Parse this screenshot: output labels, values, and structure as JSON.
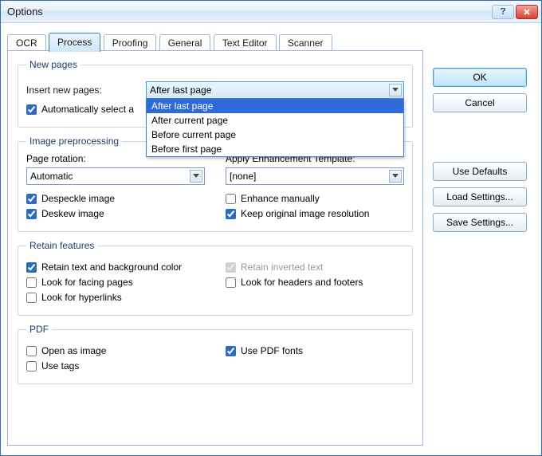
{
  "window": {
    "title": "Options"
  },
  "tabs": [
    "OCR",
    "Process",
    "Proofing",
    "General",
    "Text Editor",
    "Scanner"
  ],
  "activeTab": 1,
  "newPages": {
    "legend": "New pages",
    "insertLabel": "Insert new pages:",
    "selected": "After last page",
    "options": [
      "After last page",
      "After current page",
      "Before current page",
      "Before first page"
    ],
    "autoSelect": {
      "label": "Automatically select a",
      "checked": true
    }
  },
  "imagePre": {
    "legend": "Image preprocessing",
    "pageRotationLabel": "Page rotation:",
    "pageRotationValue": "Automatic",
    "enhLabel": "Apply Enhancement Template:",
    "enhValue": "[none]",
    "despeckle": {
      "label": "Despeckle image",
      "checked": true
    },
    "deskew": {
      "label": "Deskew image",
      "checked": true
    },
    "enhanceManually": {
      "label": "Enhance manually",
      "checked": false
    },
    "keepRes": {
      "label": "Keep original image resolution",
      "checked": true
    }
  },
  "retain": {
    "legend": "Retain features",
    "retainColor": {
      "label": "Retain text and background color",
      "checked": true
    },
    "facingPages": {
      "label": "Look for facing pages",
      "checked": false
    },
    "hyperlinks": {
      "label": "Look for hyperlinks",
      "checked": false
    },
    "inverted": {
      "label": "Retain inverted text",
      "checked": true,
      "disabled": true
    },
    "headersFooters": {
      "label": "Look for headers and footers",
      "checked": false
    }
  },
  "pdf": {
    "legend": "PDF",
    "openAsImage": {
      "label": "Open as image",
      "checked": false
    },
    "useTags": {
      "label": "Use tags",
      "checked": false
    },
    "usePDFFonts": {
      "label": "Use PDF fonts",
      "checked": true
    }
  },
  "buttons": {
    "ok": "OK",
    "cancel": "Cancel",
    "useDefaults": "Use Defaults",
    "loadSettings": "Load Settings...",
    "saveSettings": "Save Settings..."
  }
}
